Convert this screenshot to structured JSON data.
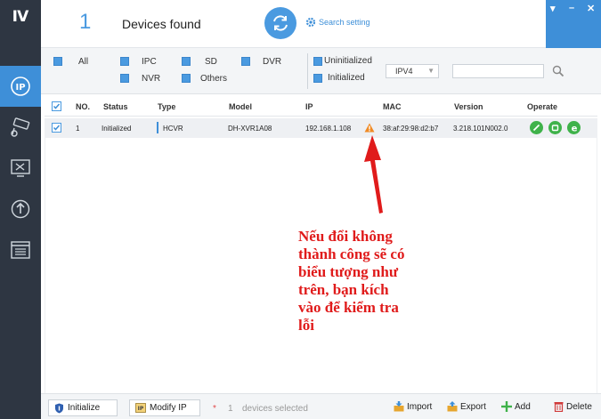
{
  "header": {
    "count": "1",
    "title": "Devices found",
    "search_setting": "Search setting"
  },
  "filters": {
    "all": "All",
    "ipc": "IPC",
    "sd": "SD",
    "dvr": "DVR",
    "nvr": "NVR",
    "others": "Others",
    "uninitialized": "Uninitialized",
    "initialized": "Initialized",
    "ip_version": "IPV4",
    "search_value": ""
  },
  "table": {
    "columns": [
      "NO.",
      "Status",
      "Type",
      "Model",
      "IP",
      "MAC",
      "Version",
      "Operate"
    ],
    "rows": [
      {
        "no": "1",
        "status": "Initialized",
        "type": "HCVR",
        "model": "DH-XVR1A08",
        "ip": "192.168.1.108",
        "mac": "38:af:29:98:d2:b7",
        "version": "3.218.101N002.0"
      }
    ]
  },
  "annotation": {
    "lines": [
      "Nếu đổi không",
      "thành công sẽ có",
      "biểu tượng như",
      "trên, bạn kích",
      "vào để kiểm tra",
      "lỗi"
    ]
  },
  "footer": {
    "initialize": "Initialize",
    "modify_ip": "Modify IP",
    "asterisk": "*",
    "selected_count": "1",
    "selected_label": "devices selected",
    "import": "Import",
    "export": "Export",
    "add": "Add",
    "delete": "Delete"
  },
  "colors": {
    "accent": "#3e8fd8",
    "rail": "#2e3642",
    "operate": "#3fb24a",
    "warning": "#f08a24",
    "annotation": "#e01b1b"
  },
  "icons": [
    "app-logo-icon",
    "ip-icon",
    "camera-icon",
    "tools-icon",
    "upgrade-icon",
    "list-icon",
    "refresh-icon",
    "gear-icon",
    "search-icon",
    "warning-icon",
    "edit-icon",
    "web-icon",
    "e-icon",
    "shield-icon",
    "modify-ip-icon",
    "import-icon",
    "export-icon",
    "add-icon",
    "delete-icon",
    "menu-icon",
    "minimize-icon",
    "close-icon"
  ]
}
